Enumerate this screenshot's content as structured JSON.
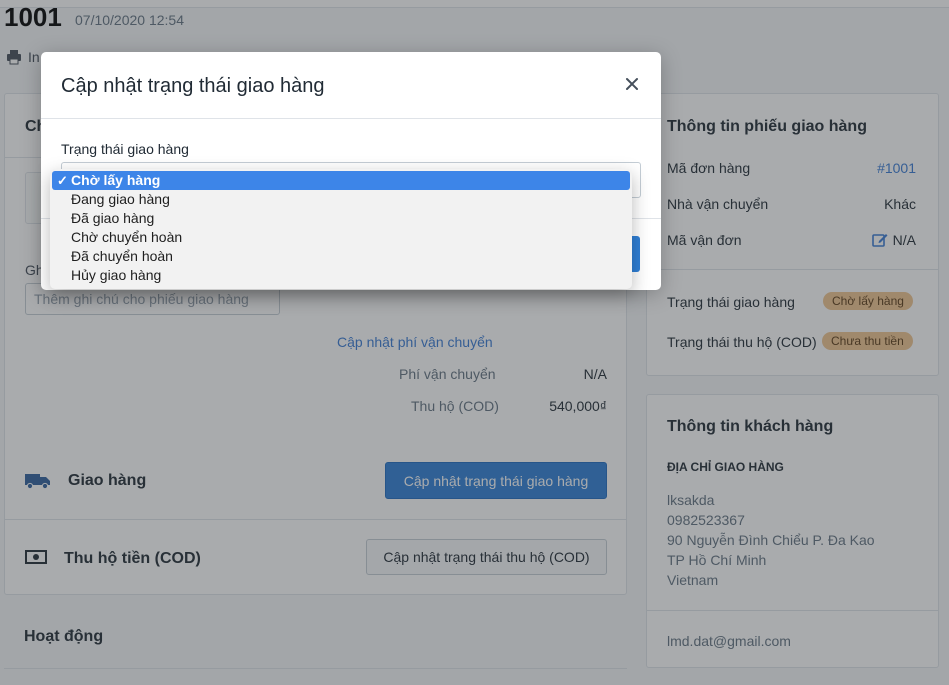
{
  "order": {
    "id": "1001",
    "date": "07/10/2020 12:54",
    "print_label": "In"
  },
  "left_panel": {
    "header_fragment": "Ch",
    "note_label_fragment": "Gh",
    "note_placeholder": "Thêm ghi chú cho phiếu giao hàng",
    "update_fee_link": "Cập nhật phí vận chuyển",
    "shipping_fee_label": "Phí vận chuyển",
    "shipping_fee_value": "N/A",
    "cod_label": "Thu hộ (COD)",
    "cod_value": "540,000₫",
    "delivery_title": "Giao hàng",
    "delivery_button": "Cập nhật trạng thái giao hàng",
    "cod_section_title": "Thu hộ tiền (COD)",
    "cod_button": "Cập nhật trạng thái thu hộ (COD)",
    "activity_title": "Hoạt động"
  },
  "shipment_info": {
    "title": "Thông tin phiếu giao hàng",
    "order_code_label": "Mã đơn hàng",
    "order_code_value": "#1001",
    "carrier_label": "Nhà vận chuyển",
    "carrier_value": "Khác",
    "tracking_label": "Mã vận đơn",
    "tracking_value": "N/A",
    "delivery_status_label": "Trạng thái giao hàng",
    "delivery_status_badge": "Chờ lấy hàng",
    "cod_status_label": "Trạng thái thu hộ (COD)",
    "cod_status_badge": "Chưa thu tiền"
  },
  "customer_info": {
    "title": "Thông tin khách hàng",
    "address_heading": "ĐỊA CHỈ GIAO HÀNG",
    "name": "lksakda",
    "phone": "0982523367",
    "street": "90 Nguyễn Đình Chiểu P. Đa Kao",
    "city": "TP Hồ Chí Minh",
    "country": "Vietnam",
    "email": "lmd.dat@gmail.com"
  },
  "modal": {
    "title": "Cập nhật trạng thái giao hàng",
    "field_label": "Trạng thái giao hàng",
    "selected_index": 0,
    "options": [
      "Chờ lấy hàng",
      "Đang giao hàng",
      "Đã giao hàng",
      "Chờ chuyển hoàn",
      "Đã chuyển hoàn",
      "Hủy giao hàng"
    ]
  },
  "colors": {
    "primary": "#2f7fd6",
    "link": "#3a7bd5",
    "badge_bg": "#f0c490",
    "dropdown_highlight": "#3d85e8"
  }
}
